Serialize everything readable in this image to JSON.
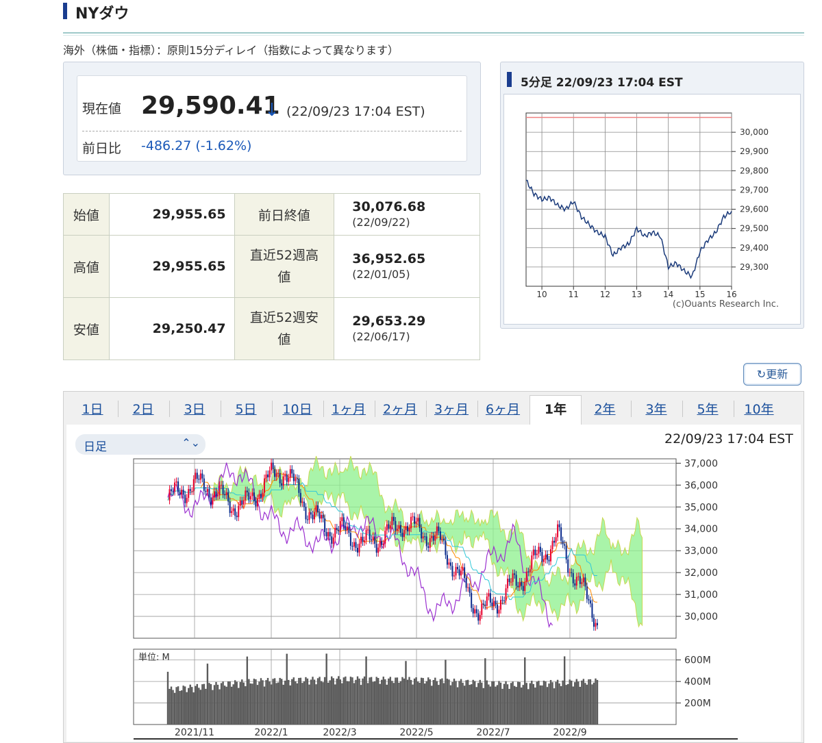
{
  "page": {
    "title": "NYダウ",
    "delay_note": "海外（株価・指標）：原則15分ディレイ（指数によって異なります）"
  },
  "current": {
    "label": "現在値",
    "value": "29,590.41",
    "arrow": "↓",
    "time": "(22/09/23 17:04 EST)",
    "change_label": "前日比",
    "change": "-486.27 (-1.62%)"
  },
  "stats": {
    "open_label": "始値",
    "open": "29,955.65",
    "high_label": "高値",
    "high": "29,955.65",
    "low_label": "安値",
    "low": "29,250.47",
    "prev_close_label": "前日終値",
    "prev_close": "30,076.68",
    "prev_close_date": "(22/09/22)",
    "high52_label_1": "直近52週高",
    "high52_label_2": "値",
    "high52": "36,952.65",
    "high52_date": "(22/01/05)",
    "low52_label_1": "直近52週安",
    "low52_label_2": "値",
    "low52": "29,653.29",
    "low52_date": "(22/06/17)"
  },
  "intraday": {
    "title": "5分足 22/09/23 17:04 EST",
    "credit": "(c)Ouants Research Inc.",
    "y_ticks": [
      "30,000",
      "29,900",
      "29,800",
      "29,700",
      "29,600",
      "29,500",
      "29,400",
      "29,300"
    ],
    "x_ticks": [
      "10",
      "11",
      "12",
      "13",
      "14",
      "15",
      "16"
    ]
  },
  "refresh_label": "更新",
  "tabs": {
    "items": [
      "1日",
      "2日",
      "3日",
      "5日",
      "10日",
      "1ヶ月",
      "2ヶ月",
      "3ヶ月",
      "6ヶ月",
      "1年",
      "2年",
      "3年",
      "5年",
      "10年"
    ],
    "active": "1年"
  },
  "main_chart": {
    "select_value": "日足",
    "time": "22/09/23 17:04 EST",
    "price_ticks": [
      "37,000",
      "36,000",
      "35,000",
      "34,000",
      "33,000",
      "32,000",
      "31,000",
      "30,000"
    ],
    "volume_unit": "単位: M",
    "volume_ticks": [
      "600M",
      "400M",
      "200M"
    ],
    "date_ticks": [
      "2021/11",
      "2022/1",
      "2022/3",
      "2022/5",
      "2022/7",
      "2022/9"
    ]
  },
  "colors": {
    "up_candle": "#e8002d",
    "down_candle": "#0a2a8c",
    "cloud_green": "#8cf08c",
    "lagging_span": "#9b30d0",
    "prev_close_line": "#f08080",
    "link": "#1a4f9c"
  },
  "chart_data": [
    {
      "type": "line",
      "title": "5分足 22/09/23 17:04 EST",
      "x_ticks": [
        10,
        11,
        12,
        13,
        14,
        15,
        16
      ],
      "xlim": [
        9.5,
        16
      ],
      "ylim": [
        29200,
        30100
      ],
      "reference_line": 30076.68,
      "series": [
        {
          "x": [
            9.5,
            9.75,
            10.0,
            10.25,
            10.5,
            10.75,
            11.0,
            11.25,
            11.5,
            11.75,
            12.0,
            12.25,
            12.5,
            12.75,
            13.0,
            13.25,
            13.5,
            13.75,
            14.0,
            14.25,
            14.5,
            14.75,
            15.0,
            15.25,
            15.5,
            15.75,
            16.0
          ],
          "y": [
            29750,
            29680,
            29650,
            29660,
            29620,
            29600,
            29640,
            29560,
            29520,
            29480,
            29460,
            29360,
            29400,
            29420,
            29500,
            29460,
            29480,
            29460,
            29300,
            29320,
            29280,
            29250,
            29380,
            29440,
            29480,
            29560,
            29590
          ]
        }
      ]
    },
    {
      "type": "line",
      "title": "",
      "ylim": [
        29000,
        37200
      ],
      "x_ticks": [
        "2021/11",
        "2022/1",
        "2022/3",
        "2022/5",
        "2022/7",
        "2022/9"
      ],
      "series": [
        {
          "x": [
            "2021/10",
            "2021/11",
            "2021/12",
            "2022/1",
            "2022/2",
            "2022/3",
            "2022/4",
            "2022/5",
            "2022/6",
            "2022/7",
            "2022/8",
            "2022/9"
          ],
          "values": [
            35300,
            35900,
            35200,
            36500,
            34300,
            33000,
            34600,
            33000,
            30500,
            31300,
            33900,
            29590
          ]
        }
      ]
    },
    {
      "type": "bar",
      "title": "",
      "ylabel": "単位: M",
      "ylim": [
        0,
        700
      ],
      "categories": [
        "2021/11",
        "2022/1",
        "2022/3",
        "2022/5",
        "2022/7",
        "2022/9"
      ],
      "values": [
        300,
        380,
        400,
        390,
        350,
        380
      ]
    }
  ]
}
